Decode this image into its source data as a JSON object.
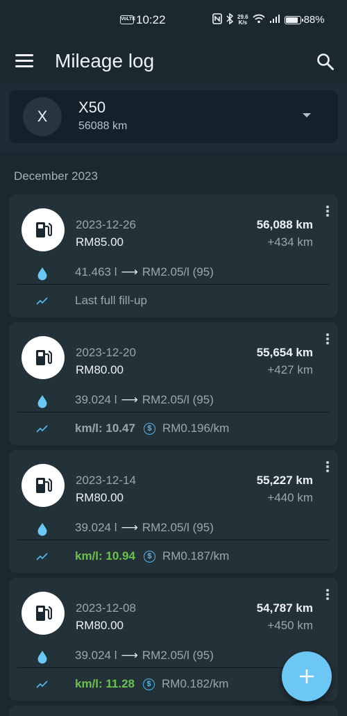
{
  "status_bar": {
    "volte": "VoLTE",
    "time": "10:22",
    "speed_value": "29.6",
    "speed_unit": "K/s",
    "battery": "88%"
  },
  "app_bar": {
    "title": "Mileage log",
    "menu_icon": "menu-icon",
    "search_icon": "search-icon"
  },
  "vehicle": {
    "initial": "X",
    "name": "X50",
    "odometer": "56088 km"
  },
  "month": "December 2023",
  "entries": [
    {
      "date": "2023-12-26",
      "cost": "RM85.00",
      "odometer": "56,088 km",
      "distance": "+434 km",
      "liters": "41.463 l",
      "price": "RM2.05/l (95)",
      "note": "Last full fill-up",
      "km_per_l": "",
      "cost_per_km": ""
    },
    {
      "date": "2023-12-20",
      "cost": "RM80.00",
      "odometer": "55,654 km",
      "distance": "+427 km",
      "liters": "39.024 l",
      "price": "RM2.05/l (95)",
      "note": "",
      "km_per_l": "km/l: 10.47",
      "cost_per_km": "RM0.196/km"
    },
    {
      "date": "2023-12-14",
      "cost": "RM80.00",
      "odometer": "55,227 km",
      "distance": "+440 km",
      "liters": "39.024 l",
      "price": "RM2.05/l (95)",
      "note": "",
      "km_per_l": "km/l: 10.94",
      "cost_per_km": "RM0.187/km"
    },
    {
      "date": "2023-12-08",
      "cost": "RM80.00",
      "odometer": "54,787 km",
      "distance": "+450 km",
      "liters": "39.024 l",
      "price": "RM2.05/l (95)",
      "note": "",
      "km_per_l": "km/l: 11.28",
      "cost_per_km": "RM0.182/km"
    }
  ],
  "colors": {
    "background": "#1b2830",
    "card": "#233139",
    "accent": "#6cc7f5",
    "efficiency_good": "#6cc04f",
    "efficiency_neutral": "#9aa7af"
  },
  "fab": {
    "icon": "plus-icon"
  },
  "arrow_glyph": "⟶"
}
